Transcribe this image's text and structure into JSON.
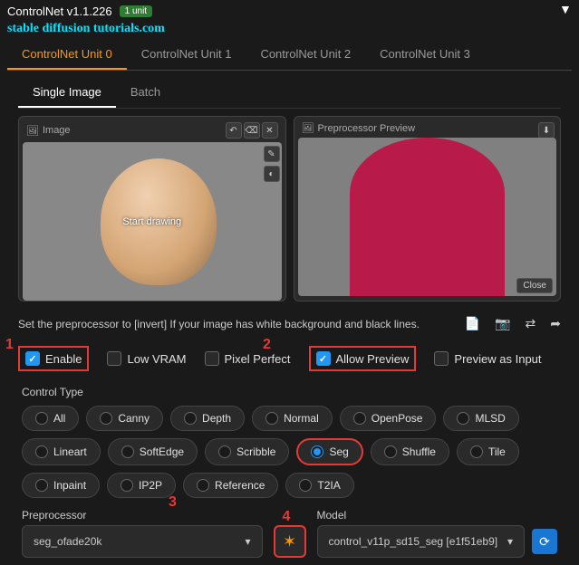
{
  "header": {
    "title": "ControlNet v1.1.226",
    "badge": "1 unit"
  },
  "watermark": "stable diffusion tutorials.com",
  "tabs": [
    "ControlNet Unit 0",
    "ControlNet Unit 1",
    "ControlNet Unit 2",
    "ControlNet Unit 3"
  ],
  "subtabs": [
    "Single Image",
    "Batch"
  ],
  "imagePanel": {
    "label": "Image",
    "overlay": "Start drawing"
  },
  "previewPanel": {
    "label": "Preprocessor Preview",
    "close": "Close"
  },
  "hint": "Set the preprocessor to [invert] If your image has white background and black lines.",
  "checks": {
    "enable": "Enable",
    "lowvram": "Low VRAM",
    "pixelperfect": "Pixel Perfect",
    "allowpreview": "Allow Preview",
    "previewasinput": "Preview as Input"
  },
  "controlTypeLabel": "Control Type",
  "controlTypes": [
    "All",
    "Canny",
    "Depth",
    "Normal",
    "OpenPose",
    "MLSD",
    "Lineart",
    "SoftEdge",
    "Scribble",
    "Seg",
    "Shuffle",
    "Tile",
    "Inpaint",
    "IP2P",
    "Reference",
    "T2IA"
  ],
  "selectedControlType": "Seg",
  "preprocessor": {
    "label": "Preprocessor",
    "value": "seg_ofade20k"
  },
  "model": {
    "label": "Model",
    "value": "control_v11p_sd15_seg [e1f51eb9]"
  },
  "annotations": {
    "a1": "1",
    "a2": "2",
    "a3": "3",
    "a4": "4"
  }
}
